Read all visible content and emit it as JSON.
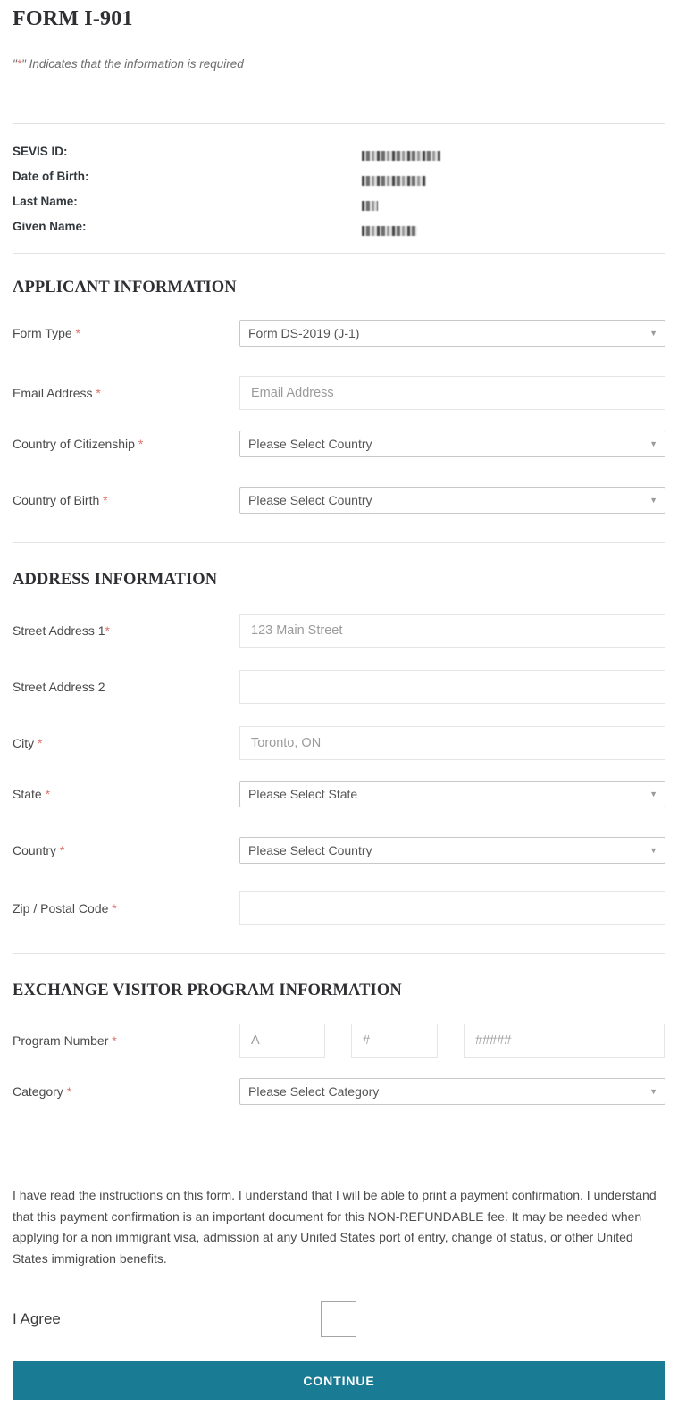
{
  "header": {
    "title": "FORM I-901",
    "required_note_prefix": "\"",
    "required_note_star": "*",
    "required_note_suffix": "\" Indicates that the information is required"
  },
  "summary": {
    "rows": [
      {
        "label": "SEVIS ID:",
        "value_redacted": true
      },
      {
        "label": "Date of Birth:",
        "value_redacted": true
      },
      {
        "label": "Last Name:",
        "value_redacted": true
      },
      {
        "label": "Given Name:",
        "value_redacted": true
      }
    ]
  },
  "applicant_information": {
    "heading": "APPLICANT INFORMATION",
    "form_type": {
      "label": "Form Type",
      "required_mark": "*",
      "value": "Form DS-2019 (J-1)"
    },
    "email_address": {
      "label": "Email Address",
      "required_mark": "*",
      "placeholder": "Email Address",
      "value": ""
    },
    "country_of_citizenship": {
      "label": "Country of Citizenship",
      "required_mark": "*",
      "value": "Please Select Country"
    },
    "country_of_birth": {
      "label": "Country of Birth",
      "required_mark": "*",
      "value": "Please Select Country"
    }
  },
  "address_information": {
    "heading": "ADDRESS INFORMATION",
    "street_address_1": {
      "label": "Street Address 1",
      "required_mark": "*",
      "placeholder": "123 Main Street",
      "value": ""
    },
    "street_address_2": {
      "label": "Street Address 2",
      "required_mark": "",
      "placeholder": "",
      "value": ""
    },
    "city": {
      "label": "City",
      "required_mark": "*",
      "placeholder": "Toronto, ON",
      "value": ""
    },
    "state": {
      "label": "State",
      "required_mark": "*",
      "value": "Please Select State"
    },
    "country": {
      "label": "Country",
      "required_mark": "*",
      "value": "Please Select Country"
    },
    "zip_postal_code": {
      "label": "Zip / Postal Code",
      "required_mark": "*",
      "placeholder": "",
      "value": ""
    }
  },
  "exchange_visitor_program_information": {
    "heading": "EXCHANGE VISITOR PROGRAM INFORMATION",
    "program_number": {
      "label": "Program Number",
      "required_mark": "*",
      "part_a_placeholder": "A",
      "part_b_placeholder": "#",
      "part_c_placeholder": "#####",
      "part_a_value": "",
      "part_b_value": "",
      "part_c_value": ""
    },
    "category": {
      "label": "Category",
      "required_mark": "*",
      "value": "Please Select Category"
    }
  },
  "agreement": {
    "text": "I have read the instructions on this form. I understand that I will be able to print a payment confirmation. I understand that this payment confirmation is an important document for this NON-REFUNDABLE fee. It may be needed when applying for a non immigrant visa, admission at any United States port of entry, change of status, or other United States immigration benefits.",
    "agree_label": "I Agree",
    "checked": false
  },
  "actions": {
    "continue_label": "CONTINUE"
  },
  "icons": {
    "dropdown_arrow": "▼"
  },
  "colors": {
    "accent_button": "#1a7b95",
    "required_star": "#e0736a",
    "heading_text": "#2f2f33",
    "label_text": "#4a4a4a",
    "divider": "#e2e2e2"
  }
}
